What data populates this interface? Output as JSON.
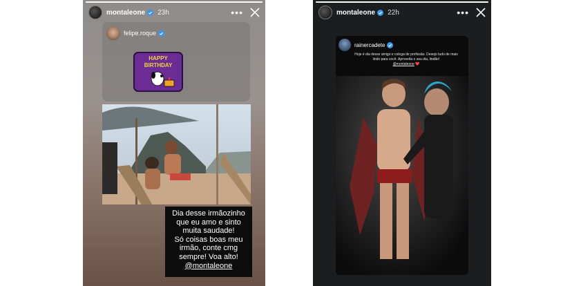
{
  "stories": [
    {
      "user": {
        "name": "montaleone",
        "time": "23h",
        "verified": true
      },
      "progress": 1.0,
      "reshare": {
        "user": "felipe.roque",
        "sticker_text": [
          "HAPPY",
          "BIRTHDAY"
        ]
      },
      "caption": {
        "lines": [
          "Dia desse irmãozinho",
          "que eu amo e sinto",
          "muita saudade!",
          "Só coisas boas meu",
          "irmão, conte cmg",
          "sempre! Voa alto!"
        ],
        "mention": "@montaleone"
      }
    },
    {
      "user": {
        "name": "montaleone",
        "time": "22h",
        "verified": true
      },
      "progress": 1.0,
      "reshare": {
        "user": "rainercadete",
        "text": "Hoje é dia desse amigo e colega de profissão. Desejo tudo de mais lindo para você. Aproveita o seu dia, lindão!",
        "mention": "@montaleone",
        "heart": "❤️"
      }
    }
  ],
  "colors": {
    "accent_verified": "#3897f0",
    "story2_bg": "#1c1d1f",
    "sticker_purple": "#6b2c96"
  },
  "icons": [
    "more-icon",
    "close-icon",
    "verified-icon"
  ]
}
